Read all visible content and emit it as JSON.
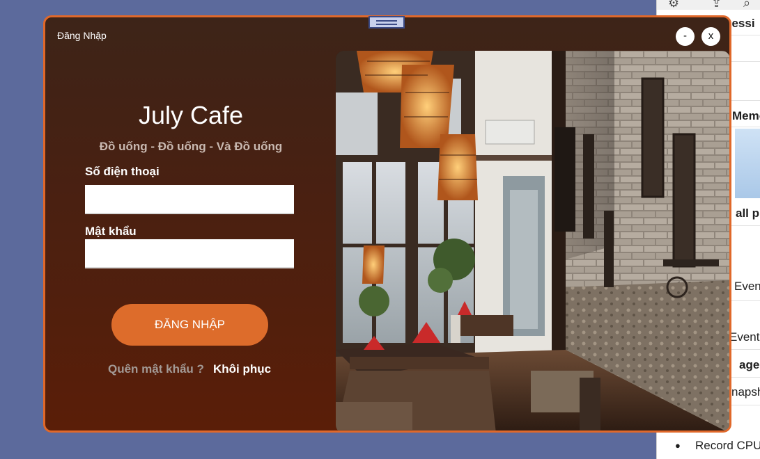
{
  "window": {
    "title": "Đăng Nhập",
    "minimize_label": "-",
    "close_label": "x"
  },
  "brand": {
    "name": "July Cafe",
    "tagline": "Đồ uống - Đồ uống - Và Đồ uống"
  },
  "form": {
    "phone_label": "Số điện thoại",
    "phone_value": "",
    "password_label": "Mật khẩu",
    "password_value": "",
    "login_button": "ĐĂNG NHẬP",
    "forgot_text": "Quên mật khẩu ?",
    "recover_link": "Khôi phục"
  },
  "colors": {
    "accent": "#dd6c2b",
    "window_border": "#e0682a",
    "window_bg": "#4a2011",
    "desktop_bg": "#5c6a9c"
  },
  "background_panel": {
    "rows": [
      "sessi",
      "Memor",
      "all pr",
      "Event",
      "Events",
      "age",
      "napsh",
      "Record CPU"
    ]
  }
}
